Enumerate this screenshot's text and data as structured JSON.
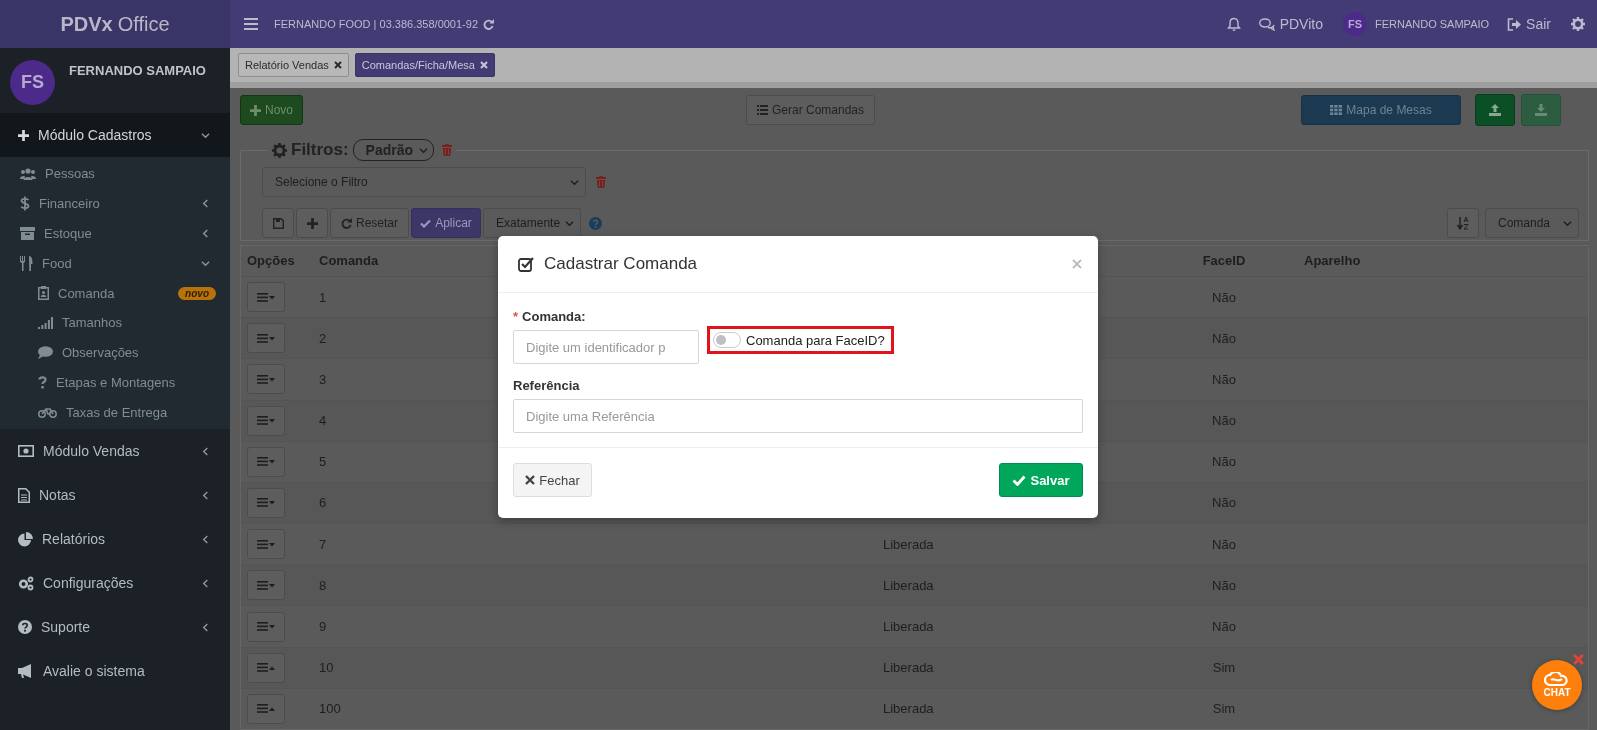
{
  "app": {
    "logo_bold": "PDVx",
    "logo_rest": "Office"
  },
  "topbar": {
    "company": "FERNANDO FOOD | 03.386.358/0001-92",
    "assistant": "PDVito",
    "user_initials": "FS",
    "user_name": "FERNANDO SAMPAIO",
    "logout": "Sair"
  },
  "sidebar": {
    "user": {
      "initials": "FS",
      "name": "FERNANDO SAMPAIO"
    },
    "items": [
      {
        "label": "Módulo Cadastros",
        "expanded": true,
        "children": [
          {
            "label": "Pessoas"
          },
          {
            "label": "Financeiro",
            "expanded": false
          },
          {
            "label": "Estoque",
            "expanded": false
          },
          {
            "label": "Food",
            "expanded": true,
            "children": [
              {
                "label": "Comanda",
                "badge": "novo"
              },
              {
                "label": "Tamanhos"
              },
              {
                "label": "Observações"
              },
              {
                "label": "Etapas e Montagens"
              },
              {
                "label": "Taxas de Entrega"
              }
            ]
          }
        ]
      },
      {
        "label": "Módulo Vendas",
        "expanded": false
      },
      {
        "label": "Notas",
        "expanded": false
      },
      {
        "label": "Relatórios",
        "expanded": false
      },
      {
        "label": "Configurações",
        "expanded": false
      },
      {
        "label": "Suporte",
        "expanded": false
      },
      {
        "label": "Avalie o sistema"
      }
    ]
  },
  "tabs": [
    {
      "label": "Relatório Vendas",
      "selected": false
    },
    {
      "label": "Comandas/Ficha/Mesa",
      "selected": true
    }
  ],
  "toolbar": {
    "new": "Novo",
    "generate": "Gerar Comandas",
    "map": "Mapa de Mesas"
  },
  "filters": {
    "title": "Filtros:",
    "preset": "Padrão",
    "filter_select": "Selecione o Filtro",
    "reset": "Resetar",
    "apply": "Aplicar",
    "match": "Exatamente",
    "sort_field": "Comanda"
  },
  "table": {
    "headers": [
      "Opções",
      "Comanda",
      "FaceID",
      "Aparelho"
    ],
    "rows": [
      {
        "comanda": "1",
        "faceid": "Não",
        "dropup": false
      },
      {
        "comanda": "2",
        "faceid": "Não",
        "dropup": false
      },
      {
        "comanda": "3",
        "faceid": "Não",
        "dropup": false
      },
      {
        "comanda": "4",
        "faceid": "Não",
        "dropup": false
      },
      {
        "comanda": "5",
        "faceid": "Não",
        "dropup": false
      },
      {
        "comanda": "6",
        "faceid": "Não",
        "dropup": false
      },
      {
        "comanda": "7",
        "column_3": "Liberada",
        "faceid": "Não",
        "dropup": false
      },
      {
        "comanda": "8",
        "column_3": "Liberada",
        "faceid": "Não",
        "dropup": false
      },
      {
        "comanda": "9",
        "column_3": "Liberada",
        "faceid": "Não",
        "dropup": false
      },
      {
        "comanda": "10",
        "column_3": "Liberada",
        "faceid": "Sim",
        "dropup": true
      },
      {
        "comanda": "100",
        "column_3": "Liberada",
        "faceid": "Sim",
        "dropup": true
      }
    ]
  },
  "modal": {
    "title": "Cadastrar Comanda",
    "required_mark": "*",
    "comanda_label": "Comanda:",
    "comanda_placeholder": "Digite um identificador p",
    "faceid_toggle": {
      "label": "Comanda para FaceID?",
      "on": false,
      "highlighted": true
    },
    "reference_label": "Referência",
    "reference_placeholder": "Digite uma Referência",
    "close": "Fechar",
    "save": "Salvar"
  },
  "chat": {
    "label": "CHAT"
  }
}
